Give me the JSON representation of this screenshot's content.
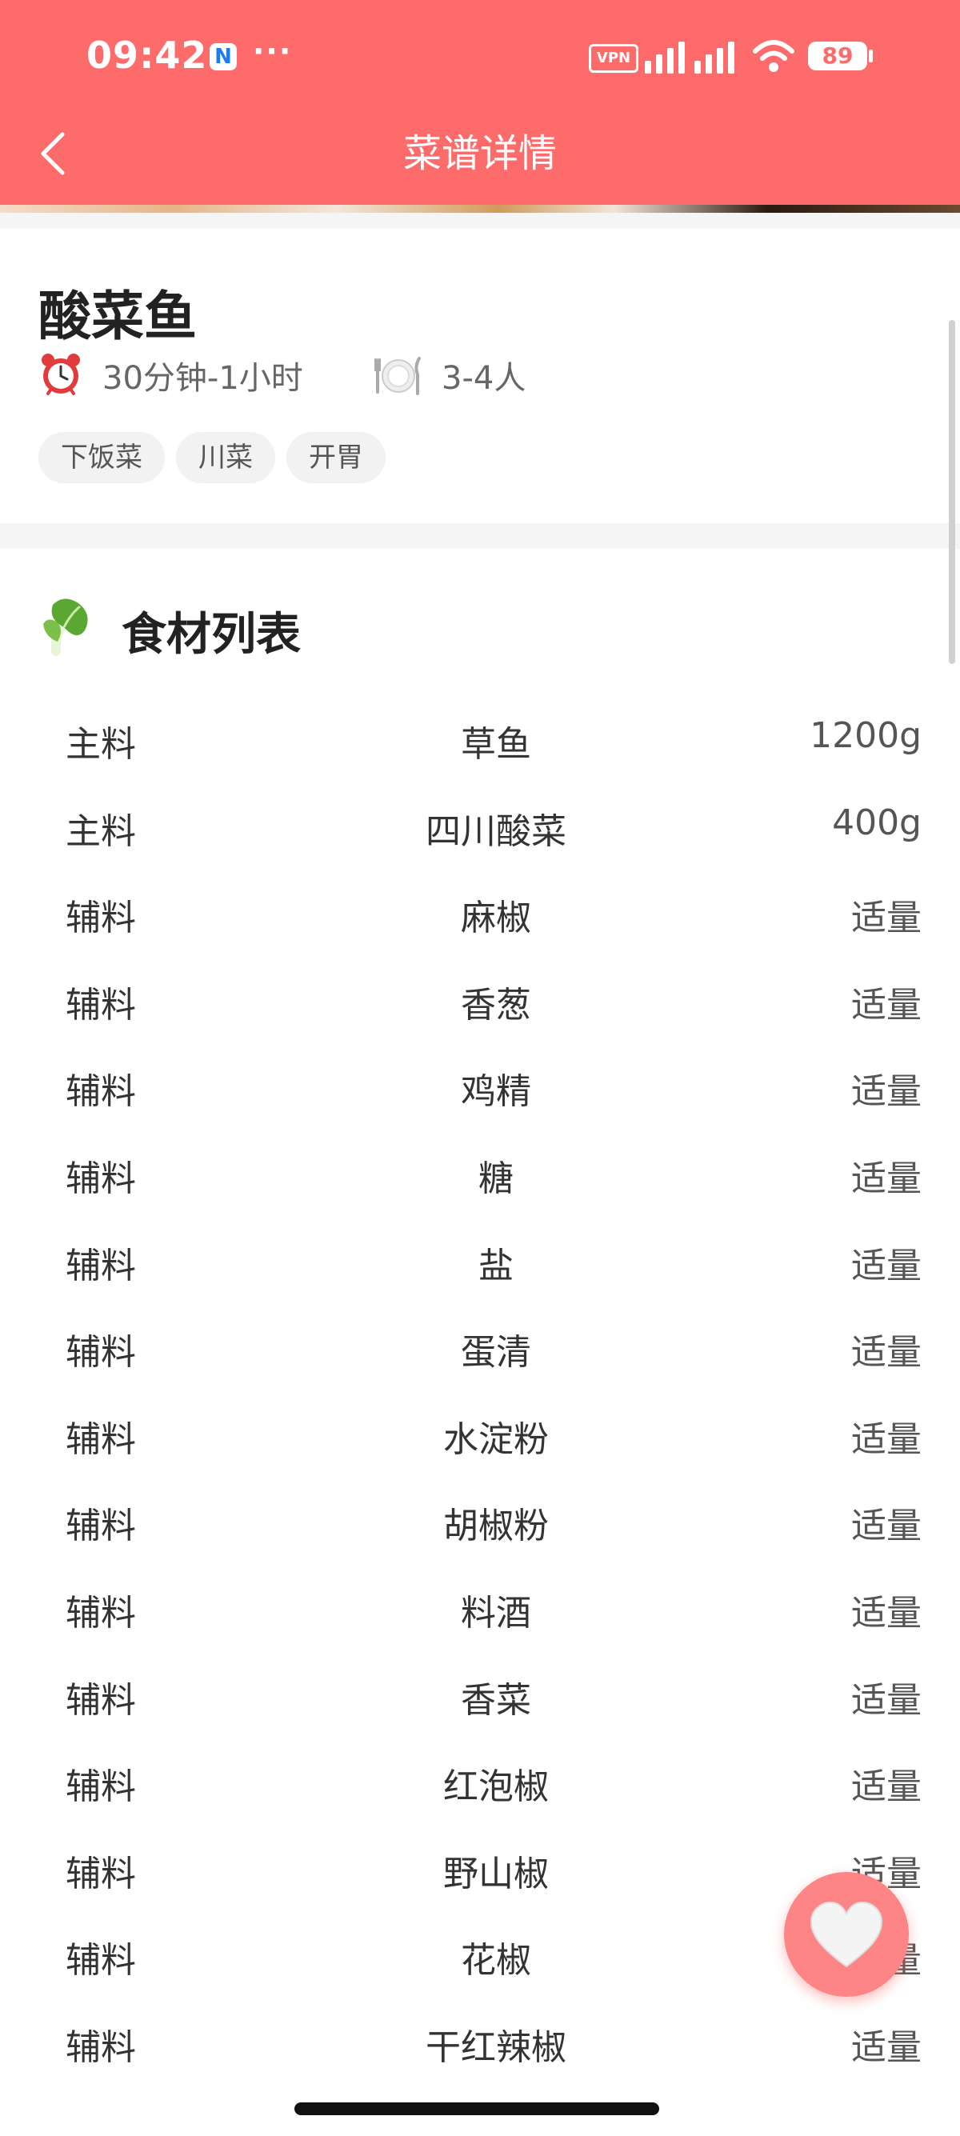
{
  "status_bar": {
    "time": "09:42",
    "app_badge": "N",
    "more": "···",
    "vpn": "VPN",
    "battery": "89"
  },
  "nav": {
    "title": "菜谱详情",
    "back_icon": "chevron-left-icon"
  },
  "recipe": {
    "title": "酸菜鱼",
    "time": "30分钟-1小时",
    "servings": "3-4人",
    "tags": [
      "下饭菜",
      "川菜",
      "开胃"
    ]
  },
  "ingredients": {
    "title": "食材列表",
    "icon": "bok-choy-icon",
    "rows": [
      {
        "type": "主料",
        "name": "草鱼",
        "qty": "1200g"
      },
      {
        "type": "主料",
        "name": "四川酸菜",
        "qty": "400g"
      },
      {
        "type": "辅料",
        "name": "麻椒",
        "qty": "适量"
      },
      {
        "type": "辅料",
        "name": "香葱",
        "qty": "适量"
      },
      {
        "type": "辅料",
        "name": "鸡精",
        "qty": "适量"
      },
      {
        "type": "辅料",
        "name": "糖",
        "qty": "适量"
      },
      {
        "type": "辅料",
        "name": "盐",
        "qty": "适量"
      },
      {
        "type": "辅料",
        "name": "蛋清",
        "qty": "适量"
      },
      {
        "type": "辅料",
        "name": "水淀粉",
        "qty": "适量"
      },
      {
        "type": "辅料",
        "name": "胡椒粉",
        "qty": "适量"
      },
      {
        "type": "辅料",
        "name": "料酒",
        "qty": "适量"
      },
      {
        "type": "辅料",
        "name": "香菜",
        "qty": "适量"
      },
      {
        "type": "辅料",
        "name": "红泡椒",
        "qty": "适量"
      },
      {
        "type": "辅料",
        "name": "野山椒",
        "qty": "适量"
      },
      {
        "type": "辅料",
        "name": "花椒",
        "qty": "适量"
      },
      {
        "type": "辅料",
        "name": "干红辣椒",
        "qty": "适量"
      }
    ]
  },
  "colors": {
    "brand": "#fd6b6b",
    "fab": "#fd8585"
  }
}
